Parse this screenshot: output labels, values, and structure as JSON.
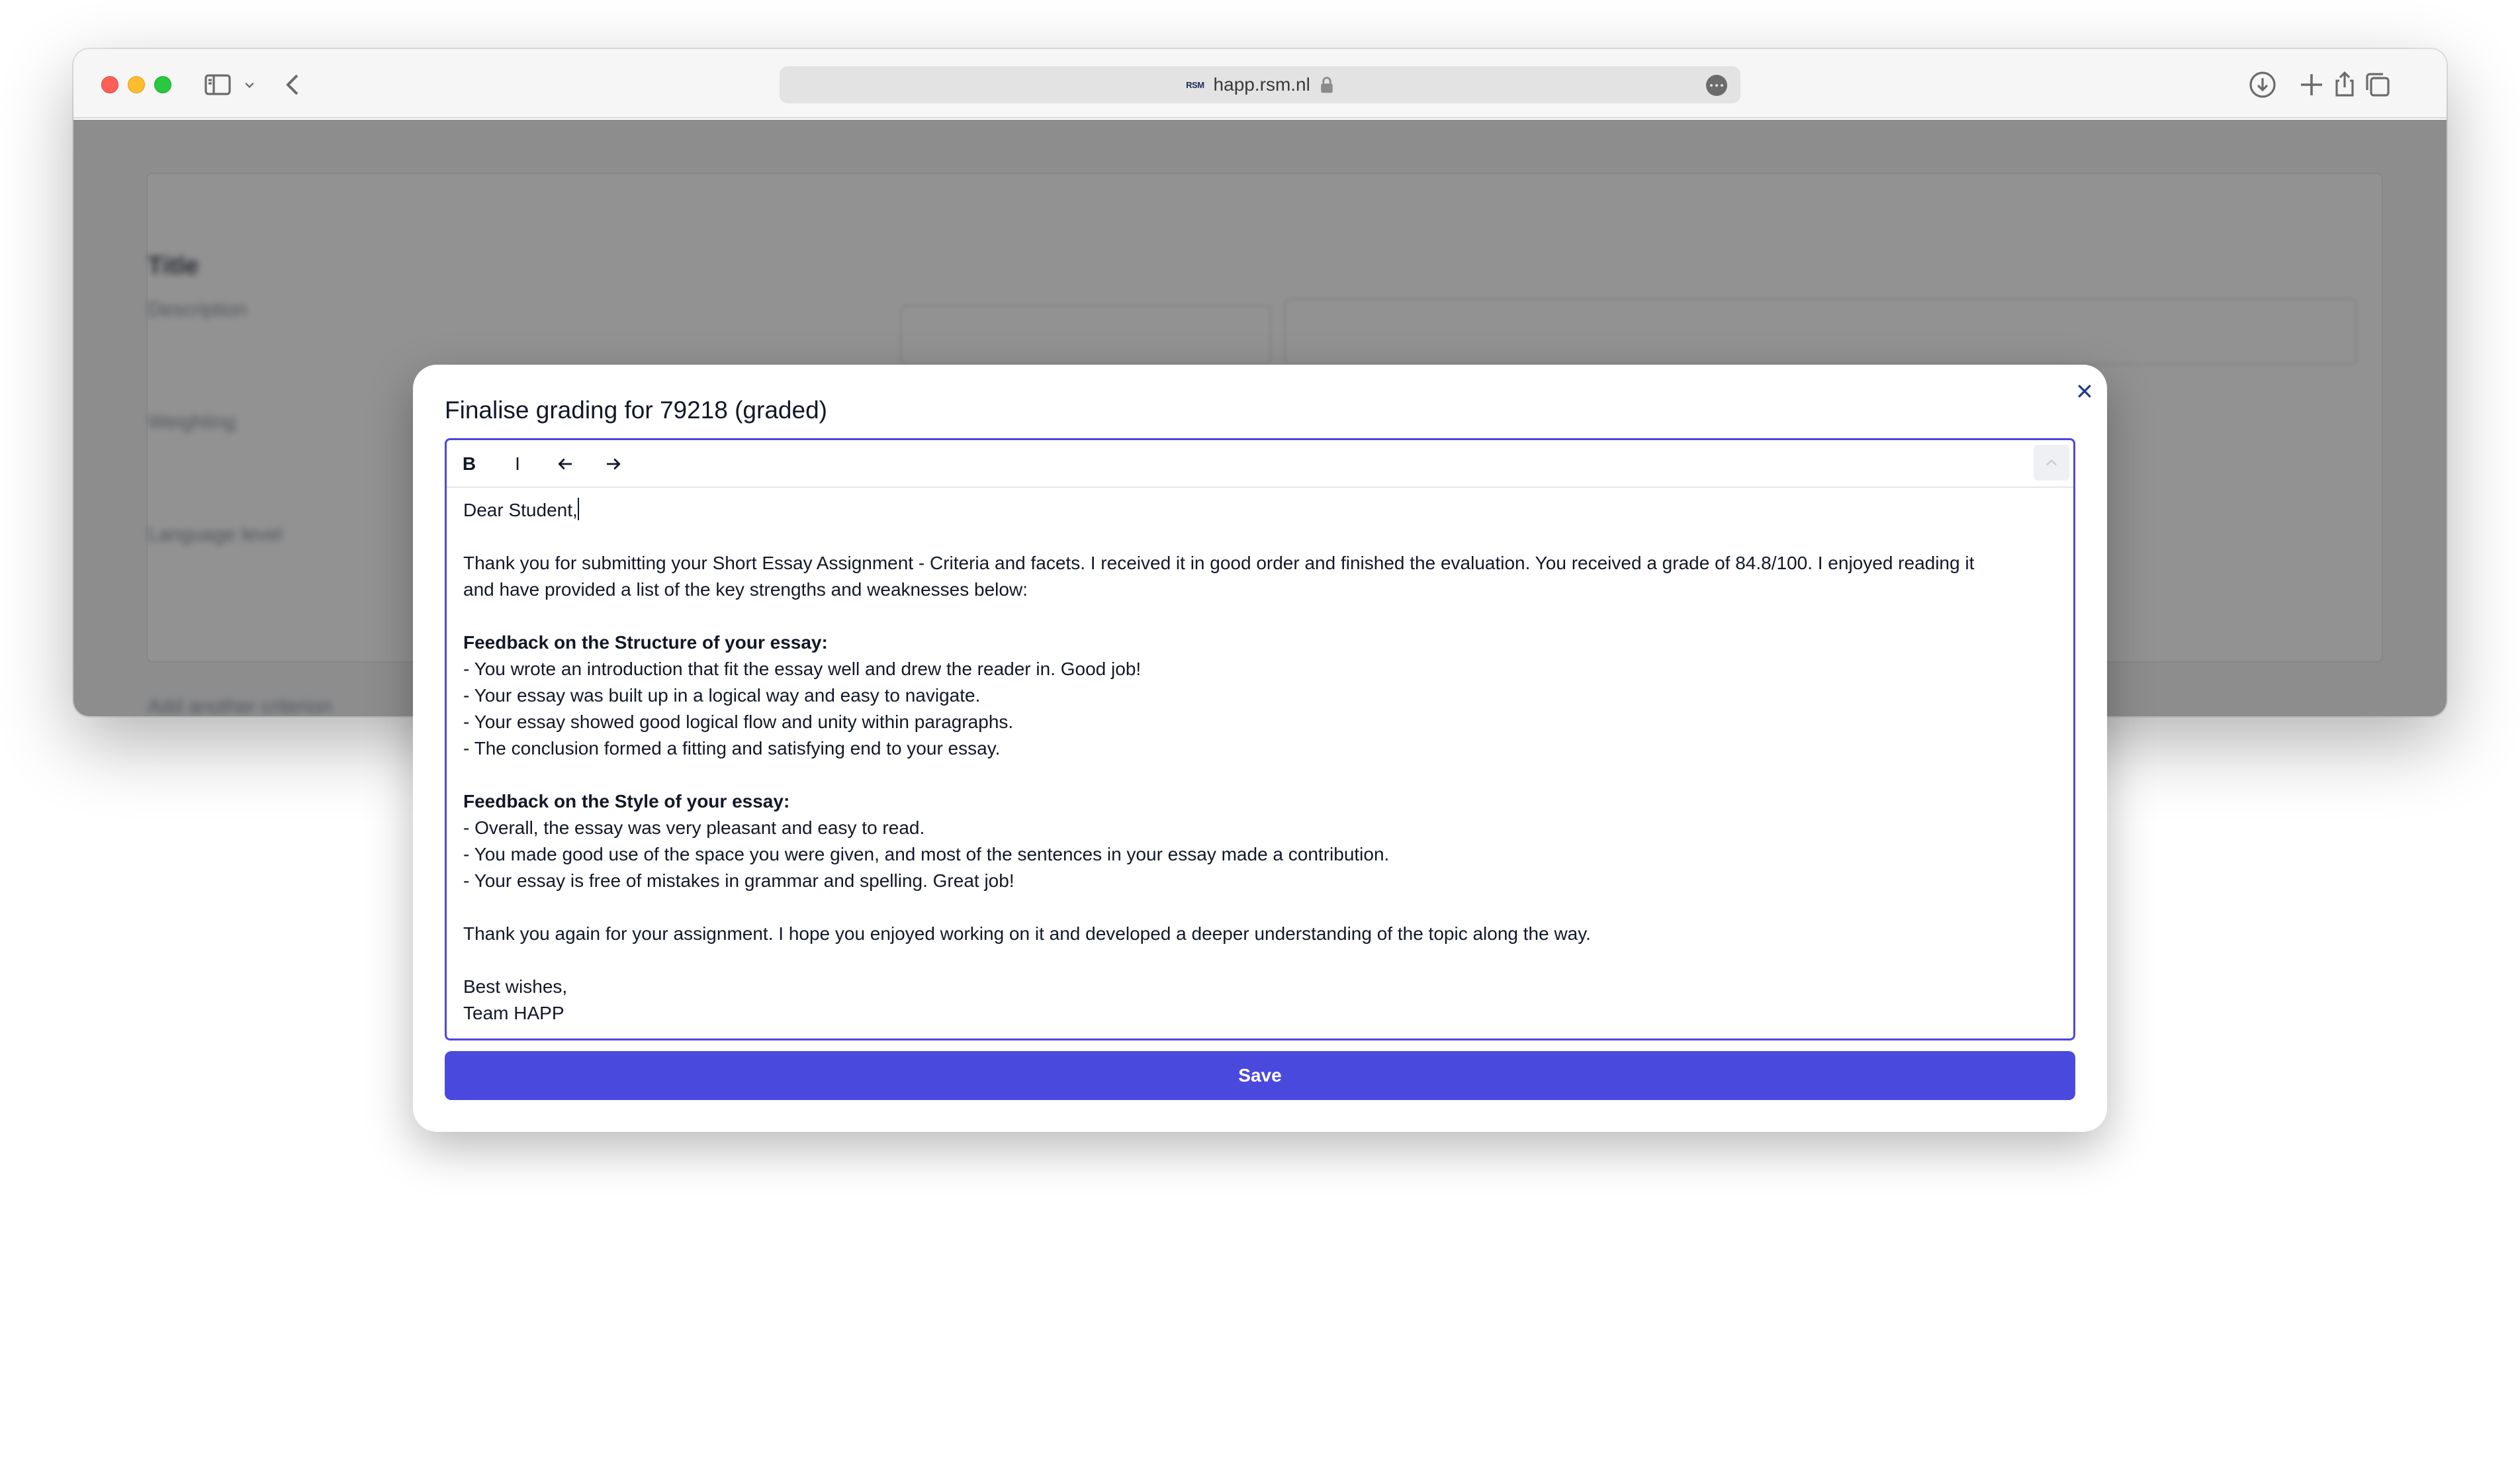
{
  "browser": {
    "url_logo": "RSM",
    "url": "happ.rsm.nl"
  },
  "modal": {
    "title": "Finalise grading for 79218 (graded)",
    "toolbar": {
      "bold_label": "B",
      "italic_label": "I"
    },
    "letter": {
      "greeting": "Dear Student,",
      "intro_line1": "Thank you for submitting your Short Essay Assignment - Criteria and facets. I received it in good order and finished the evaluation. You received a grade of 84.8/100. I enjoyed reading it",
      "intro_line2": "and have provided a list of the key strengths and weaknesses below:",
      "structure_heading": "Feedback on the Structure of your essay:",
      "structure_items": [
        "- You wrote an introduction that fit the essay well and drew the reader in. Good job!",
        "- Your essay was built up in a logical way and easy to navigate.",
        "- Your essay showed good logical flow and unity within paragraphs.",
        "- The conclusion formed a fitting and satisfying end to your essay."
      ],
      "style_heading": "Feedback on the Style of your essay:",
      "style_items": [
        "- Overall, the essay was very pleasant and easy to read.",
        "- You made good use of the space you were given, and most of the sentences in your essay made a contribution.",
        "- Your essay is free of mistakes in grammar and spelling. Great job!"
      ],
      "closing": "Thank you again for your assignment. I hope you enjoyed working on it and developed a deeper understanding of the topic along the way.",
      "signoff": "Best wishes,",
      "signature": "Team HAPP"
    },
    "save_label": "Save"
  },
  "colors": {
    "accent": "#4f46e5",
    "save_button": "#4a49de",
    "hidden_action_button": "#ea580c"
  }
}
